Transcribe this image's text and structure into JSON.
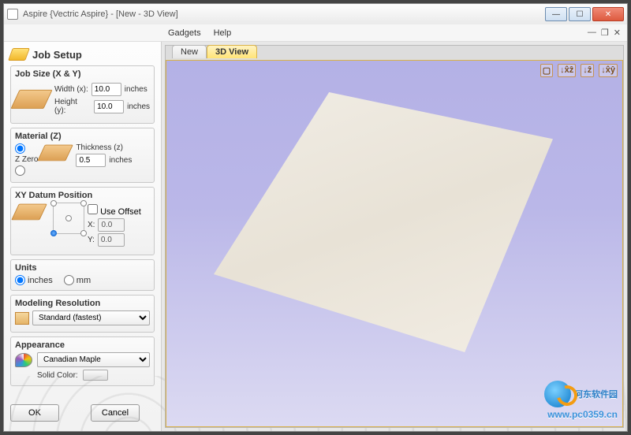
{
  "window": {
    "title": "Aspire {Vectric Aspire} - [New - 3D View]"
  },
  "menu": {
    "gadgets": "Gadgets",
    "help": "Help"
  },
  "panel": {
    "header": "Job Setup",
    "jobSize": {
      "title": "Job Size (X & Y)",
      "widthLabel": "Width (x):",
      "widthValue": "10.0",
      "heightLabel": "Height (y):",
      "heightValue": "10.0",
      "units": "inches"
    },
    "material": {
      "title": "Material (Z)",
      "zZero": "Z Zero",
      "thicknessLabel": "Thickness (z)",
      "thicknessValue": "0.5",
      "units": "inches"
    },
    "datum": {
      "title": "XY Datum Position",
      "useOffset": "Use Offset",
      "xLabel": "X:",
      "xValue": "0.0",
      "yLabel": "Y:",
      "yValue": "0.0"
    },
    "units": {
      "title": "Units",
      "inches": "inches",
      "mm": "mm"
    },
    "resolution": {
      "title": "Modeling Resolution",
      "selected": "Standard (fastest)"
    },
    "appearance": {
      "title": "Appearance",
      "selected": "Canadian Maple",
      "solidLabel": "Solid Color:"
    },
    "ok": "OK",
    "cancel": "Cancel"
  },
  "tabs": {
    "new": "New",
    "view3d": "3D View"
  },
  "viewIcons": {
    "iso": "▢",
    "xz": "↓x̂ẑ",
    "yz": "↓ẑ",
    "xy": "↓x̂ŷ"
  },
  "watermark": {
    "line1": "河东软件园",
    "line2": "www.pc0359.cn"
  }
}
